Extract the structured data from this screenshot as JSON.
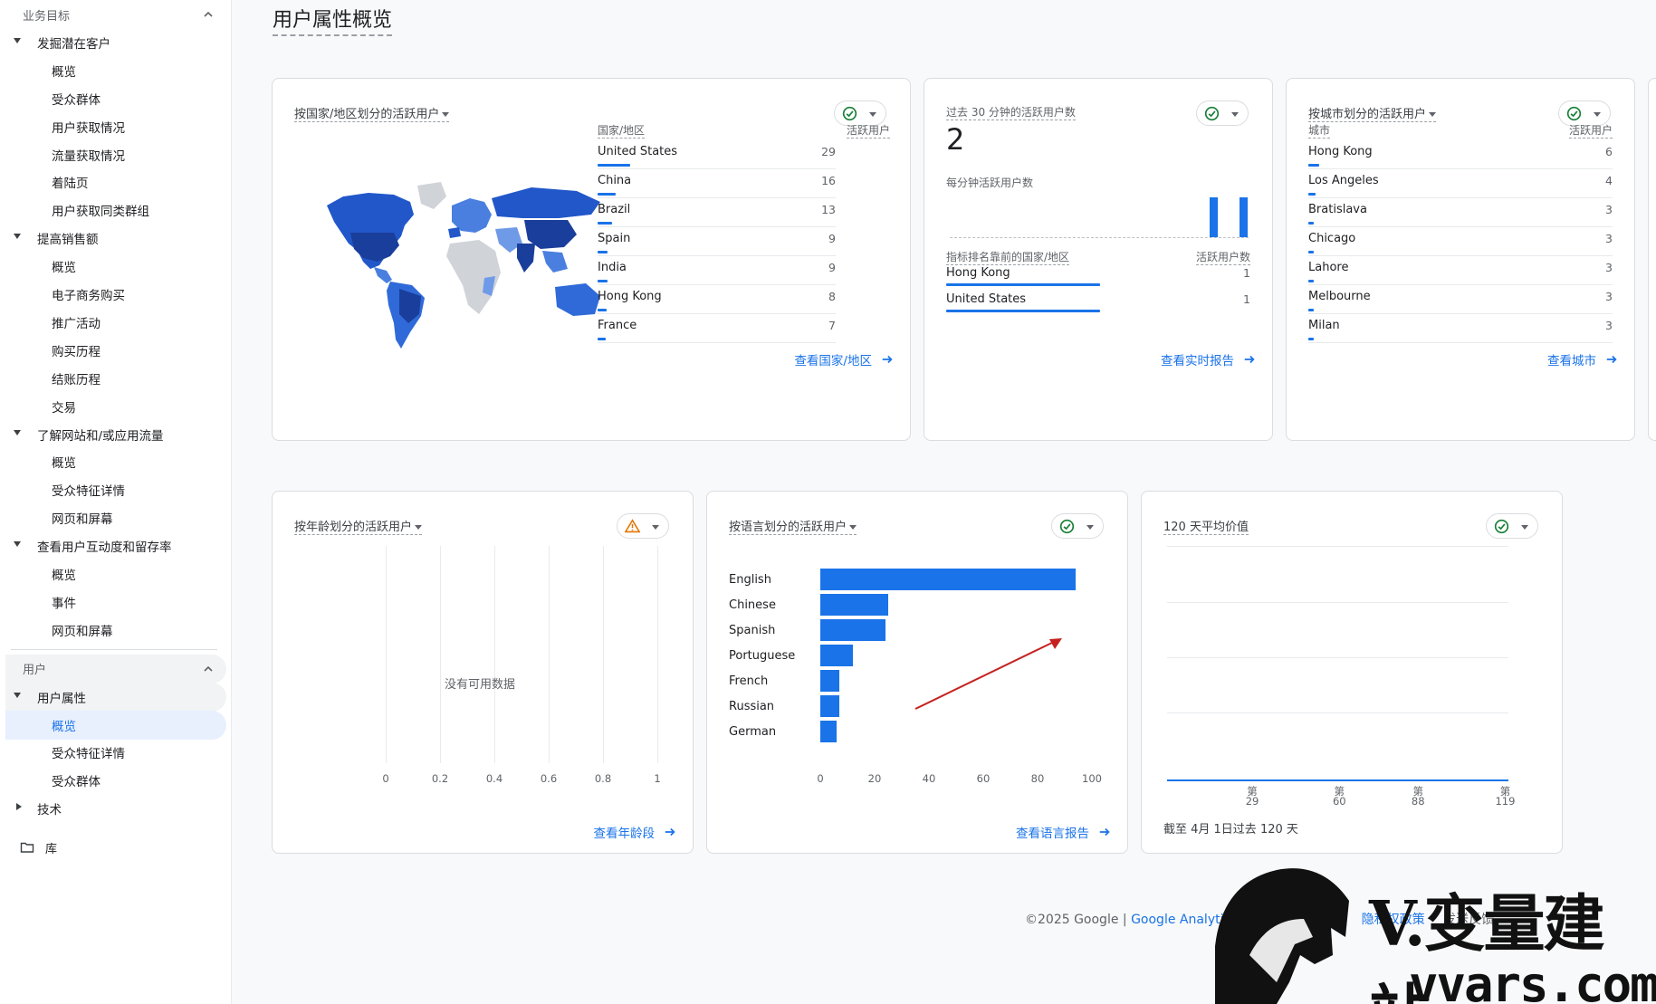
{
  "sidebar": {
    "section_business": "业务目标",
    "groups": [
      {
        "label": "发掘潜在客户",
        "items": [
          "概览",
          "受众群体",
          "用户获取情况",
          "流量获取情况",
          "着陆页",
          "用户获取同类群组"
        ]
      },
      {
        "label": "提高销售额",
        "items": [
          "概览",
          "电子商务购买",
          "推广活动",
          "购买历程",
          "结账历程",
          "交易"
        ]
      },
      {
        "label": "了解网站和/或应用流量",
        "items": [
          "概览",
          "受众特征详情",
          "网页和屏幕"
        ]
      },
      {
        "label": "查看用户互动度和留存率",
        "items": [
          "概览",
          "事件",
          "网页和屏幕"
        ]
      }
    ],
    "section_user": "用户",
    "user_group": {
      "label": "用户属性",
      "items": [
        "概览",
        "受众特征详情",
        "受众群体"
      ]
    },
    "tech_label": "技术",
    "library_label": "库"
  },
  "page_title": "用户属性概览",
  "country_card": {
    "title": "按国家/地区划分的活跃用户",
    "col_country": "国家/地区",
    "col_users": "活跃用户",
    "rows": [
      {
        "name": "United States",
        "value": "29",
        "frac": 1.0
      },
      {
        "name": "China",
        "value": "16",
        "frac": 0.55
      },
      {
        "name": "Brazil",
        "value": "13",
        "frac": 0.45
      },
      {
        "name": "Spain",
        "value": "9",
        "frac": 0.31
      },
      {
        "name": "India",
        "value": "9",
        "frac": 0.31
      },
      {
        "name": "Hong Kong",
        "value": "8",
        "frac": 0.28
      },
      {
        "name": "France",
        "value": "7",
        "frac": 0.24
      }
    ],
    "link": "查看国家/地区",
    "status": "ok"
  },
  "realtime_card": {
    "title": "过去 30 分钟的活跃用户数",
    "big_number": "2",
    "per_minute_label": "每分钟活跃用户数",
    "per_minute_bars": [
      0,
      0,
      0,
      0,
      0,
      0,
      0,
      0,
      0,
      0,
      0,
      0,
      0,
      0,
      0,
      0,
      0,
      0,
      0,
      0,
      0,
      0,
      0,
      0,
      0,
      0,
      1,
      0,
      0,
      1
    ],
    "col_country": "指标排名靠前的国家/地区",
    "col_users": "活跃用户数",
    "rows": [
      {
        "name": "Hong Kong",
        "value": "1",
        "frac": 1.0
      },
      {
        "name": "United States",
        "value": "1",
        "frac": 1.0
      }
    ],
    "link": "查看实时报告",
    "status": "ok"
  },
  "city_card": {
    "title": "按城市划分的活跃用户",
    "col_city": "城市",
    "col_users": "活跃用户",
    "rows": [
      {
        "name": "Hong Kong",
        "value": "6",
        "frac": 1.0
      },
      {
        "name": "Los Angeles",
        "value": "4",
        "frac": 0.67
      },
      {
        "name": "Bratislava",
        "value": "3",
        "frac": 0.5
      },
      {
        "name": "Chicago",
        "value": "3",
        "frac": 0.5
      },
      {
        "name": "Lahore",
        "value": "3",
        "frac": 0.5
      },
      {
        "name": "Melbourne",
        "value": "3",
        "frac": 0.5
      },
      {
        "name": "Milan",
        "value": "3",
        "frac": 0.5
      }
    ],
    "link": "查看城市",
    "status": "ok"
  },
  "age_card": {
    "title": "按年龄划分的活跃用户",
    "no_data": "没有可用数据",
    "ticks": [
      "0",
      "0.2",
      "0.4",
      "0.6",
      "0.8",
      "1"
    ],
    "link": "查看年龄段",
    "status": "warning"
  },
  "language_card": {
    "title": "按语言划分的活跃用户",
    "link": "查看语言报告",
    "status": "ok"
  },
  "value_card": {
    "title": "120 天平均价值",
    "x_ticks": [
      {
        "line1": "第",
        "line2": "29"
      },
      {
        "line1": "第",
        "line2": "60"
      },
      {
        "line1": "第",
        "line2": "88"
      },
      {
        "line1": "第",
        "line2": "119"
      }
    ],
    "caption": "截至 4月 1日过去 120 天",
    "status": "ok"
  },
  "footer": {
    "copyright": "©2025 Google | ",
    "link": "Google Analytic",
    "privacy": "隐私权政策",
    "feedback": "发送反馈"
  },
  "watermark": {
    "name": "V.变量建站",
    "url": "vvars.com"
  },
  "colors": {
    "accent": "#1a73e8",
    "ok": "#188038",
    "warn": "#e37400",
    "annotation_arrow": "#c5221f"
  },
  "chart_data": {
    "type": "bar",
    "title": "按语言划分的活跃用户",
    "categories": [
      "English",
      "Chinese",
      "Spanish",
      "Portuguese",
      "French",
      "Russian",
      "German"
    ],
    "values": [
      94,
      25,
      24,
      12,
      7,
      7,
      6
    ],
    "xlim": [
      0,
      100
    ],
    "x_ticks": [
      "0",
      "20",
      "40",
      "60",
      "80",
      "100"
    ],
    "orientation": "horizontal",
    "grid": false
  }
}
